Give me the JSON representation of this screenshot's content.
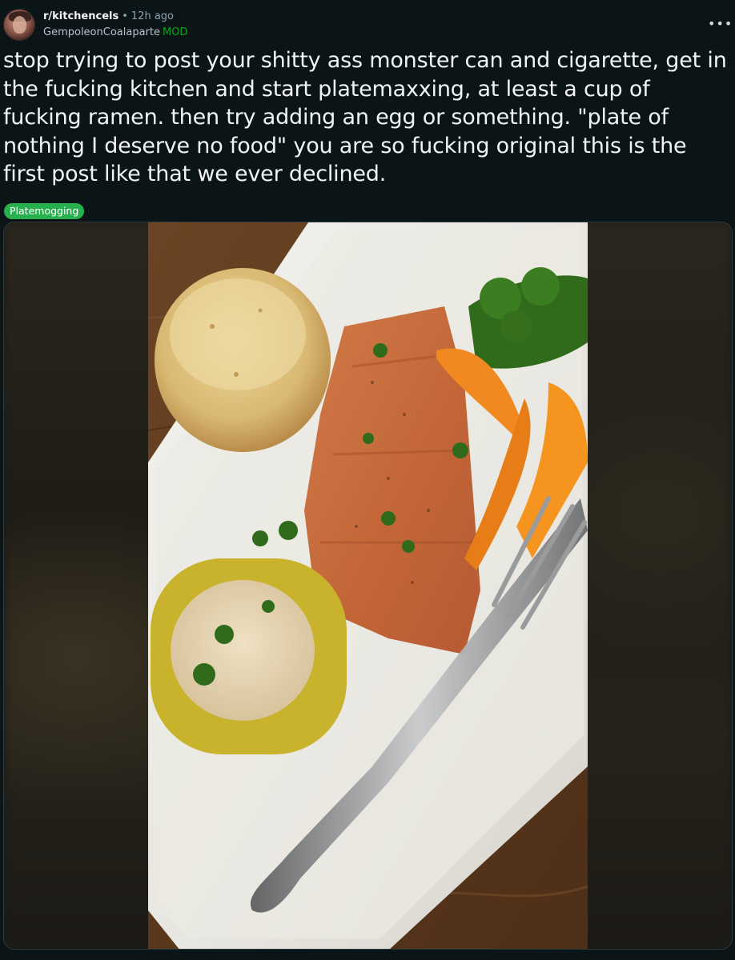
{
  "post": {
    "subreddit": "r/kitchencels",
    "separator": "•",
    "time_ago": "12h ago",
    "author": "GempoleonCoalaparte",
    "author_badge": "MOD",
    "more_label": "•••",
    "title": "stop trying to post your shitty ass monster can and cigarette, get in the fucking kitchen and start platemaxxing, at least a cup of fucking ramen. then try adding an egg or something. \"plate of nothing I deserve no food\" you are so fucking original this is the first post like that we ever declined.",
    "flair": "Platemogging",
    "flair_color": "#28b04e",
    "badge_color": "#01a816"
  },
  "media": {
    "type": "image",
    "icons": [
      "kebab-menu-icon",
      "avatar"
    ],
    "photo_subject": "salmon-plate-photo"
  }
}
